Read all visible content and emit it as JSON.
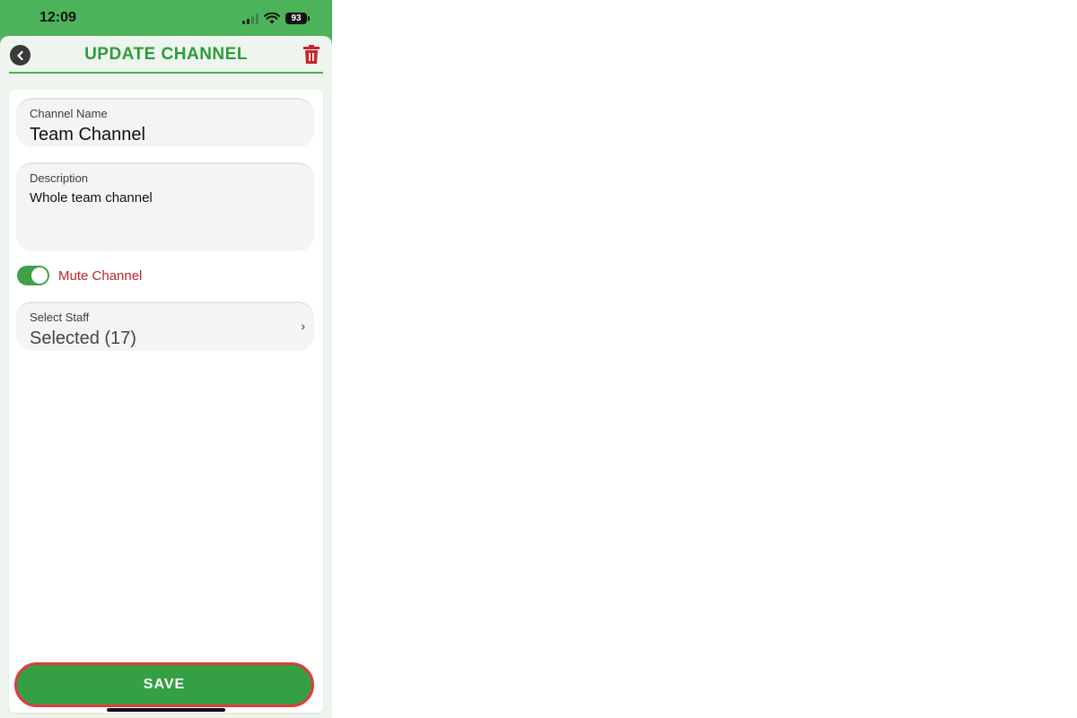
{
  "status_bar": {
    "time": "12:09",
    "battery": "93"
  },
  "header": {
    "title": "UPDATE CHANNEL"
  },
  "form": {
    "channel_name": {
      "label": "Channel Name",
      "value": "Team Channel"
    },
    "description": {
      "label": "Description",
      "value": "Whole team channel"
    },
    "mute": {
      "label": "Mute Channel",
      "checked": true
    },
    "staff": {
      "label": "Select Staff",
      "value": "Selected (17)",
      "chevron": "›"
    }
  },
  "footer": {
    "save_label": "SAVE"
  },
  "colors": {
    "brand_green": "#34a043",
    "title_green": "#2e9b3c",
    "danger_red": "#b8262c",
    "highlight_border": "#e23b40"
  }
}
